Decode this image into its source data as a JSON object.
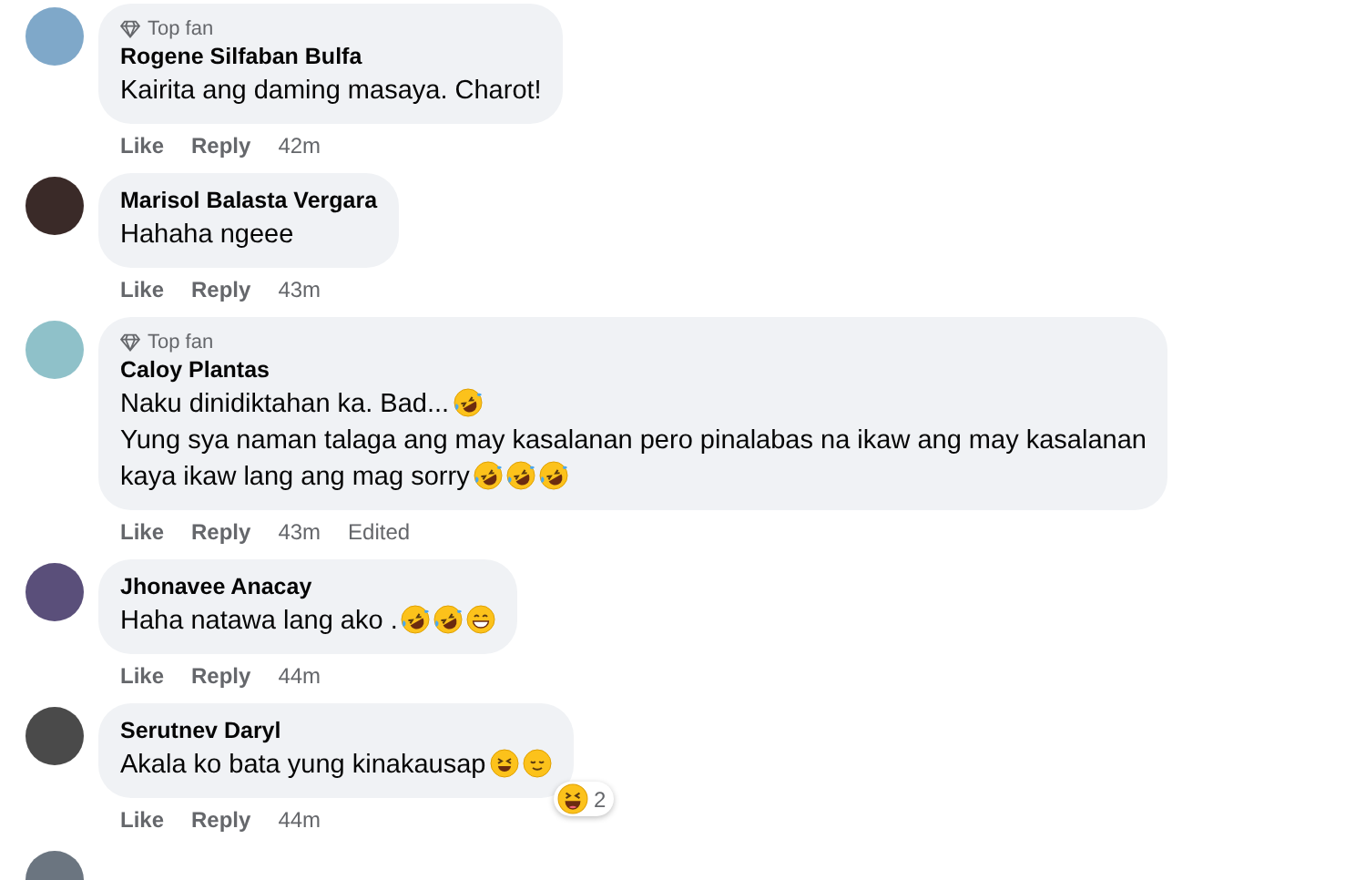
{
  "comments": [
    {
      "top_fan": true,
      "top_fan_label": "Top fan",
      "name": "Rogene Silfaban Bulfa",
      "lines": [
        {
          "text": "Kairita ang daming masaya. Charot!"
        }
      ],
      "actions": {
        "like": "Like",
        "reply": "Reply",
        "time": "42m"
      }
    },
    {
      "top_fan": false,
      "name": "Marisol Balasta Vergara",
      "lines": [
        {
          "text": "Hahaha ngeee"
        }
      ],
      "actions": {
        "like": "Like",
        "reply": "Reply",
        "time": "43m"
      }
    },
    {
      "top_fan": true,
      "top_fan_label": "Top fan",
      "name": "Caloy Plantas",
      "lines": [
        {
          "text": "Naku dinidiktahan ka. Bad...",
          "emojis": [
            {
              "kind": "rofl"
            }
          ]
        },
        {
          "text": "Yung sya naman talaga ang may kasalanan pero pinalabas na ikaw ang may kasalanan"
        },
        {
          "text": "kaya ikaw lang ang mag sorry",
          "emojis": [
            {
              "kind": "rofl"
            },
            {
              "kind": "rofl"
            },
            {
              "kind": "rofl"
            }
          ]
        }
      ],
      "actions": {
        "like": "Like",
        "reply": "Reply",
        "time": "43m",
        "edited": "Edited"
      }
    },
    {
      "top_fan": false,
      "name": "Jhonavee Anacay",
      "lines": [
        {
          "text": "Haha natawa lang ako .",
          "emojis": [
            {
              "kind": "rofl"
            },
            {
              "kind": "rofl"
            },
            {
              "kind": "grin"
            }
          ]
        }
      ],
      "actions": {
        "like": "Like",
        "reply": "Reply",
        "time": "44m"
      }
    },
    {
      "top_fan": false,
      "name": "Serutnev Daryl",
      "lines": [
        {
          "text": "Akala ko bata yung kinakausap",
          "emojis": [
            {
              "kind": "squint"
            },
            {
              "kind": "relieved"
            }
          ]
        }
      ],
      "reaction": {
        "kind": "laugh",
        "count": "2"
      },
      "actions": {
        "like": "Like",
        "reply": "Reply",
        "time": "44m"
      }
    }
  ]
}
